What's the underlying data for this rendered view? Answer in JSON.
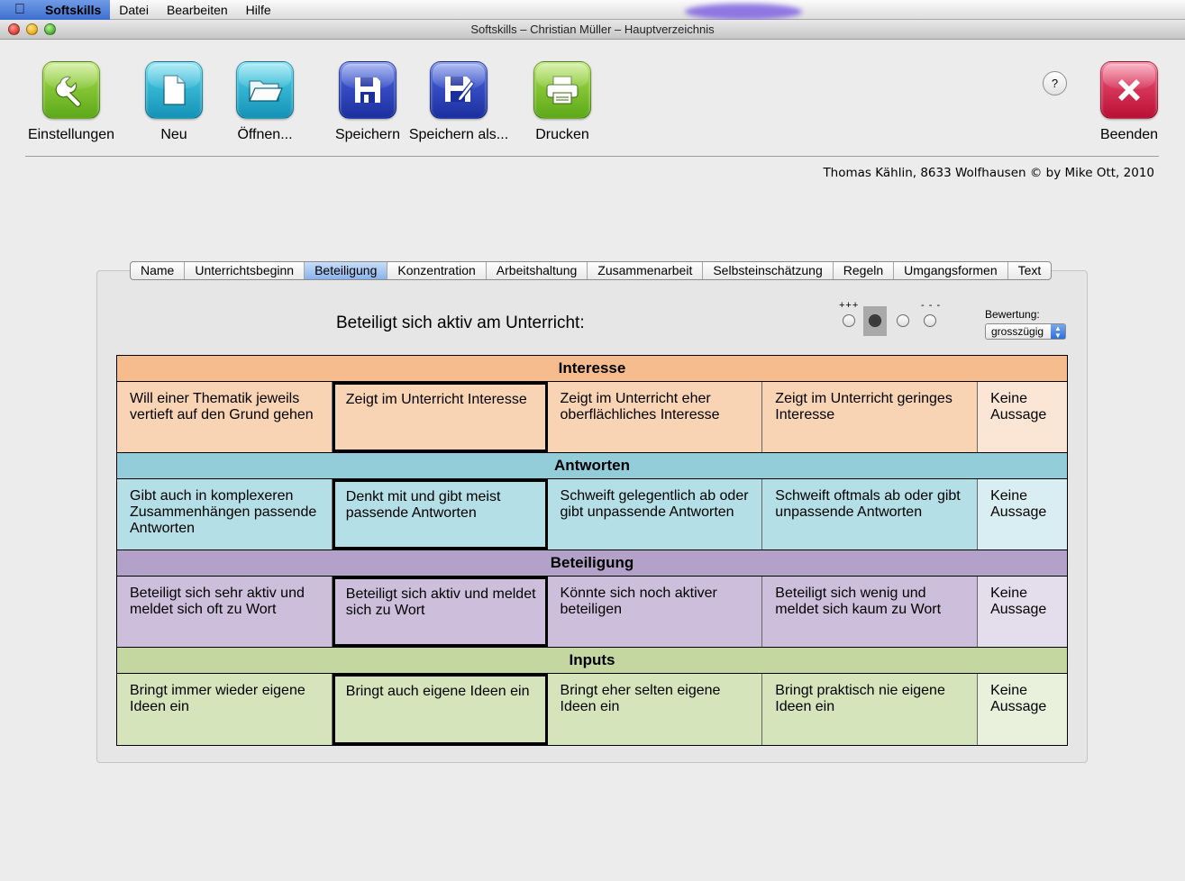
{
  "menubar": {
    "app": "Softskills",
    "items": [
      "Datei",
      "Bearbeiten",
      "Hilfe"
    ]
  },
  "window": {
    "title": "Softskills – Christian Müller – Hauptverzeichnis"
  },
  "toolbar": {
    "settings": "Einstellungen",
    "new": "Neu",
    "open": "Öffnen...",
    "save": "Speichern",
    "save_as": "Speichern als...",
    "print": "Drucken",
    "quit": "Beenden",
    "help": "?"
  },
  "credit": "Thomas Kählin, 8633 Wolfhausen © by Mike Ott, 2010",
  "tabs": [
    "Name",
    "Unterrichtsbeginn",
    "Beteiligung",
    "Konzentration",
    "Arbeitshaltung",
    "Zusammenarbeit",
    "Selbsteinschätzung",
    "Regeln",
    "Umgangsformen",
    "Text"
  ],
  "active_tab": "Beteiligung",
  "question": "Beteiligt sich aktiv am Unterricht:",
  "scale": {
    "plus": "+++",
    "minus": "- - -",
    "selected_index": 1
  },
  "rating": {
    "label": "Bewertung:",
    "value": "grosszügig"
  },
  "grid": {
    "sections": [
      {
        "title": "Interesse",
        "cells": [
          "Will einer Thematik jeweils vertieft auf den Grund gehen",
          "Zeigt im Unterricht Interesse",
          "Zeigt im Unterricht eher oberflächliches Interesse",
          "Zeigt im Unterricht geringes Interesse",
          "Keine Aussage"
        ]
      },
      {
        "title": "Antworten",
        "cells": [
          "Gibt auch in komplexeren Zusammenhängen passende Antworten",
          "Denkt mit und gibt meist passende Antworten",
          "Schweift gelegentlich ab oder gibt unpassende Antworten",
          "Schweift oftmals ab oder gibt unpassende Antworten",
          "Keine Aussage"
        ]
      },
      {
        "title": "Beteiligung",
        "cells": [
          "Beteiligt sich sehr aktiv und meldet sich oft zu Wort",
          "Beteiligt sich aktiv und meldet sich zu Wort",
          "Könnte sich noch aktiver beteiligen",
          "Beteiligt sich wenig und meldet sich kaum zu Wort",
          "Keine Aussage"
        ]
      },
      {
        "title": "Inputs",
        "cells": [
          "Bringt immer wieder eigene Ideen ein",
          "Bringt auch eigene Ideen ein",
          "Bringt eher selten eigene Ideen ein",
          "Bringt praktisch nie eigene Ideen ein",
          "Keine Aussage"
        ]
      }
    ]
  }
}
